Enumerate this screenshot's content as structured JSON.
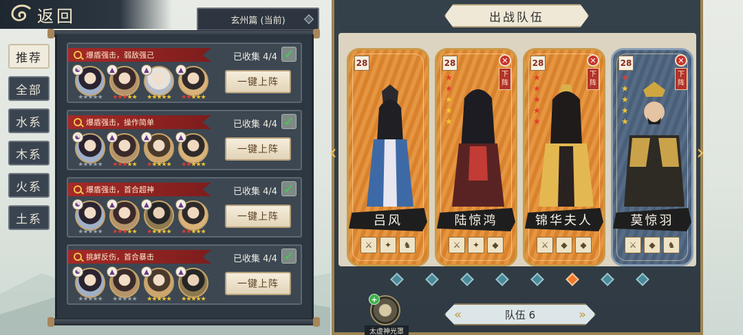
{
  "header": {
    "back_label": "返回",
    "chapter_label": "玄州篇 (当前)"
  },
  "tabs": [
    "推荐",
    "全部",
    "水系",
    "木系",
    "火系",
    "土系"
  ],
  "lineups": [
    {
      "desc": "爆盾强击，弱敌强己",
      "collected": "已收集 4/4",
      "button": "一键上阵",
      "heroes": [
        {
          "c": "c1",
          "elem": "☯",
          "stars": [
            "g",
            "g",
            "g",
            "g",
            "g"
          ]
        },
        {
          "c": "c2",
          "elem": "▲",
          "stars": [
            "r",
            "r",
            "r",
            "y",
            "y"
          ]
        },
        {
          "c": "c3",
          "elem": "▲",
          "stars": [
            "y",
            "y",
            "y",
            "y",
            "y"
          ]
        },
        {
          "c": "c4",
          "elem": "▲",
          "stars": [
            "r",
            "r",
            "y",
            "y",
            "y"
          ]
        }
      ]
    },
    {
      "desc": "爆盾强击，操作简单",
      "collected": "已收集 4/4",
      "button": "一键上阵",
      "heroes": [
        {
          "c": "c1",
          "elem": "☯",
          "stars": [
            "g",
            "g",
            "g",
            "g",
            "g"
          ]
        },
        {
          "c": "c2",
          "elem": "▲",
          "stars": [
            "r",
            "r",
            "r",
            "y",
            "y"
          ]
        },
        {
          "c": "c6",
          "elem": "▲",
          "stars": [
            "r",
            "y",
            "y",
            "y",
            "y"
          ]
        },
        {
          "c": "c4",
          "elem": "▲",
          "stars": [
            "r",
            "r",
            "y",
            "y",
            "y"
          ]
        }
      ]
    },
    {
      "desc": "爆盾强击，首合超神",
      "collected": "已收集 4/4",
      "button": "一键上阵",
      "heroes": [
        {
          "c": "c1",
          "elem": "☯",
          "stars": [
            "g",
            "g",
            "g",
            "g",
            "g"
          ]
        },
        {
          "c": "c2",
          "elem": "▲",
          "stars": [
            "r",
            "r",
            "r",
            "y",
            "y"
          ]
        },
        {
          "c": "c5",
          "elem": "▲",
          "stars": [
            "r",
            "y",
            "y",
            "y",
            "y"
          ]
        },
        {
          "c": "c4",
          "elem": "▲",
          "stars": [
            "r",
            "r",
            "y",
            "y",
            "y"
          ]
        }
      ]
    },
    {
      "desc": "挑衅反伤，首合暴击",
      "collected": "已收集 4/4",
      "button": "一键上阵",
      "heroes": [
        {
          "c": "c1",
          "elem": "☯",
          "stars": [
            "g",
            "g",
            "g",
            "g",
            "g"
          ]
        },
        {
          "c": "c2",
          "elem": "▲",
          "stars": [
            "g",
            "g",
            "g",
            "g",
            "g"
          ]
        },
        {
          "c": "c6",
          "elem": "▲",
          "stars": [
            "y",
            "y",
            "y",
            "y",
            "y"
          ]
        },
        {
          "c": "c5",
          "elem": "▲",
          "stars": [
            "y",
            "y",
            "y",
            "y",
            "y"
          ]
        }
      ]
    }
  ],
  "battle": {
    "title": "出战队伍",
    "down_label": [
      "下",
      "阵"
    ],
    "cards": [
      {
        "name": "吕风",
        "level": "28",
        "stars": [],
        "removable": false,
        "theme": "orange",
        "equip": [
          "⚔",
          "✦",
          "♞"
        ]
      },
      {
        "name": "陆惊鸿",
        "level": "28",
        "stars": [
          "r",
          "r",
          "y",
          "y",
          "y"
        ],
        "removable": true,
        "theme": "orange",
        "equip": [
          "⚔",
          "✦",
          "◆"
        ]
      },
      {
        "name": "锦华夫人",
        "level": "28",
        "stars": [
          "r",
          "r",
          "r",
          "r",
          "r"
        ],
        "removable": true,
        "theme": "orange",
        "equip": [
          "⚔",
          "◆",
          "◆"
        ]
      },
      {
        "name": "莫惊羽",
        "level": "28",
        "stars": [
          "r",
          "y",
          "y",
          "y",
          "y"
        ],
        "removable": true,
        "theme": "blue",
        "equip": [
          "⚔",
          "◆",
          "♞"
        ]
      }
    ],
    "pages": 8,
    "active_page": 6,
    "team_label": "队伍 6",
    "halo_label": "太虚神光罩"
  }
}
